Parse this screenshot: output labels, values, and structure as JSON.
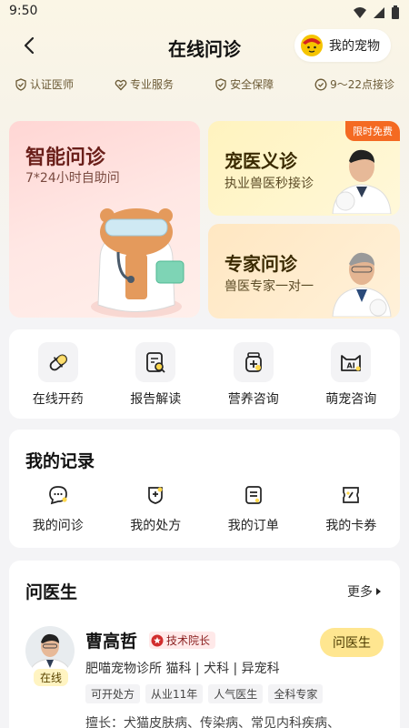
{
  "status": {
    "time": "9:50"
  },
  "header": {
    "title": "在线问诊",
    "pet_button": "我的宠物"
  },
  "badges": [
    "认证医师",
    "专业服务",
    "安全保障",
    "9～22点接诊"
  ],
  "banners": {
    "main": {
      "title": "智能问诊",
      "subtitle": "7*24小时自助问"
    },
    "vet": {
      "title": "宠医义诊",
      "subtitle": "执业兽医秒接诊",
      "tag": "限时免费"
    },
    "expert": {
      "title": "专家问诊",
      "subtitle": "兽医专家一对一"
    }
  },
  "services": [
    "在线开药",
    "报告解读",
    "营养咨询",
    "萌宠咨询"
  ],
  "records": {
    "title": "我的记录",
    "items": [
      "我的问诊",
      "我的处方",
      "我的订单",
      "我的卡券"
    ]
  },
  "doctors": {
    "title": "问医生",
    "more": "更多",
    "doctor": {
      "name": "曹高哲",
      "rank": "技术院长",
      "status": "在线",
      "ask_label": "问医生",
      "info": "肥喵宠物诊所  猫科 | 犬科 | 异宠科",
      "tags": [
        "可开处方",
        "从业11年",
        "人气医生",
        "全科专家"
      ],
      "skill": "擅长：犬猫皮肤病、传染病、常见内科疾病、"
    }
  },
  "colors": {
    "accent": "#FFE690",
    "free_tag": "#F46A22",
    "rank_bg": "#FFE9E9"
  }
}
